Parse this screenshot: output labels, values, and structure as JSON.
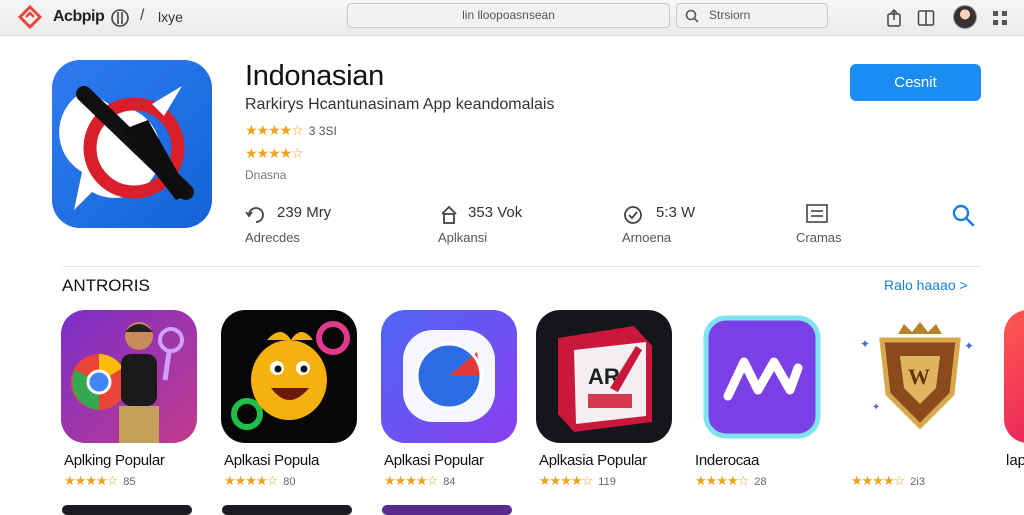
{
  "topbar": {
    "brand": "Acbpip",
    "crumb": "lxye",
    "address": "lin lloopoasnsean",
    "search_text": "Strsiorn"
  },
  "app": {
    "title": "Indonasian",
    "subtitle": "Rarkirys Hcantunasinam App keandomalais",
    "rating1_stars": "★★★★☆",
    "rating1_value": "3 3SI",
    "rating2_stars": "★★★★☆",
    "developer": "Dnasna",
    "get_label": "Cesnit"
  },
  "stats": [
    {
      "value": "239 Mry",
      "label": "Adrecdes",
      "icon": "refresh-icon"
    },
    {
      "value": "353 Vok",
      "label": "Aplkansi",
      "icon": "upload-icon"
    },
    {
      "value": "5:3 W",
      "label": "Arnoena",
      "icon": "check-shield-icon"
    },
    {
      "value": "",
      "label": "Cramas",
      "icon": "document-icon"
    }
  ],
  "section": {
    "title": "ANTRORIS",
    "see_all": "Ralo haaao >"
  },
  "cards": [
    {
      "name": "Aplking Popular",
      "stars": "★★★★☆",
      "count": "85"
    },
    {
      "name": "Aplkasi Popula",
      "stars": "★★★★☆",
      "count": "80"
    },
    {
      "name": "Aplkasi Popular",
      "stars": "★★★★☆",
      "count": "84"
    },
    {
      "name": "Aplkasia Popular",
      "stars": "★★★★☆",
      "count": "119"
    },
    {
      "name": "Inderocaa",
      "stars": "★★★★☆",
      "count": "28"
    },
    {
      "name": "",
      "stars": "★★★★☆",
      "count": "2i3"
    }
  ],
  "partial_card": {
    "name": "lap"
  },
  "colors": {
    "accent": "#1a8cf2",
    "star": "#f0a21a"
  }
}
